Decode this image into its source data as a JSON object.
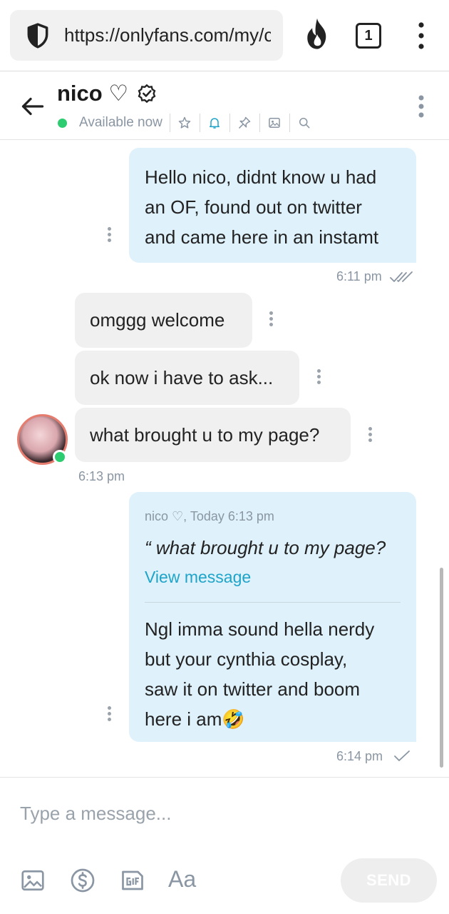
{
  "browser": {
    "url": "https://onlyfans.com/my/chats",
    "tab_count": "1"
  },
  "chat": {
    "name": "nico ♡",
    "status": "Available now"
  },
  "messages": [
    {
      "lines": [
        "Hello nico, didnt know u had",
        "an OF, found out on twitter",
        "and came here in an instamt"
      ],
      "time": "6:11 pm"
    },
    {
      "text": "omggg welcome"
    },
    {
      "text": "ok now i have to ask..."
    },
    {
      "text": "what brought u to my page?",
      "time": "6:13 pm"
    },
    {
      "quote_meta": "nico ♡, Today 6:13 pm",
      "quote_text": "“ what brought u to my page?",
      "view_link": "View message",
      "lines": [
        "Ngl imma sound hella nerdy",
        "but your cynthia cosplay,",
        "saw it on twitter and boom",
        "here i am🤣"
      ],
      "time": "6:14 pm"
    }
  ],
  "composer": {
    "placeholder": "Type a message...",
    "format_label": "Aa",
    "send_label": "SEND"
  },
  "colors": {
    "outgoing_bubble": "#dff1fb",
    "incoming_bubble": "#f0f0f0",
    "online": "#2ecc71",
    "accent": "#1ea4c9"
  }
}
